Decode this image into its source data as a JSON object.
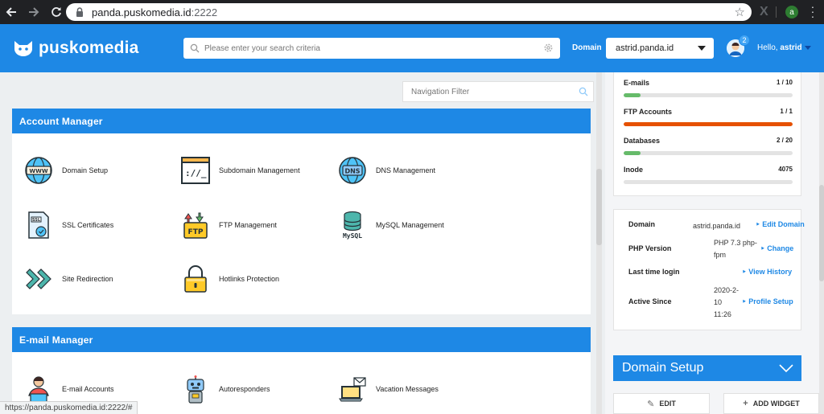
{
  "browser": {
    "url_host": "panda.puskomedia.id",
    "url_port": ":2222",
    "profile_initial": "a"
  },
  "header": {
    "brand": "puskomedia",
    "search_placeholder": "Please enter your search criteria",
    "domain_label": "Domain",
    "domain_value": "astrid.panda.id",
    "notification_count": "2",
    "hello_prefix": "Hello,",
    "username": "astrid"
  },
  "nav_filter": {
    "placeholder": "Navigation Filter"
  },
  "account_manager": {
    "title": "Account Manager",
    "items": [
      {
        "label": "Domain Setup",
        "icon": "globe-www-icon"
      },
      {
        "label": "Subdomain Management",
        "icon": "terminal-window-icon"
      },
      {
        "label": "DNS Management",
        "icon": "dns-globe-icon"
      },
      {
        "label": "SSL Certificates",
        "icon": "ssl-document-icon"
      },
      {
        "label": "FTP Management",
        "icon": "ftp-folder-icon"
      },
      {
        "label": "MySQL Management",
        "icon": "mysql-database-icon"
      },
      {
        "label": "Site Redirection",
        "icon": "redirect-arrows-icon"
      },
      {
        "label": "Hotlinks Protection",
        "icon": "padlock-icon"
      }
    ]
  },
  "email_manager": {
    "title": "E-mail Manager",
    "items": [
      {
        "label": "E-mail Accounts",
        "icon": "email-user-icon"
      },
      {
        "label": "Autoresponders",
        "icon": "robot-icon"
      },
      {
        "label": "Vacation Messages",
        "icon": "laptop-mail-icon"
      }
    ]
  },
  "usage": [
    {
      "name": "E-mails",
      "value": "1 / 10",
      "fraction": 0.1,
      "color": "#66bb6a"
    },
    {
      "name": "FTP Accounts",
      "value": "1 / 1",
      "fraction": 1.0,
      "color": "#e65100"
    },
    {
      "name": "Databases",
      "value": "2 / 20",
      "fraction": 0.1,
      "color": "#66bb6a"
    },
    {
      "name": "Inode",
      "value": "4075",
      "fraction": 0,
      "color": "#66bb6a"
    }
  ],
  "info": {
    "domain_key": "Domain",
    "domain_val": "astrid.panda.id",
    "domain_action": "Edit Domain",
    "php_key": "PHP Version",
    "php_val": "PHP 7.3 php-fpm",
    "php_action": "Change",
    "login_key": "Last time login",
    "login_action": "View History",
    "since_key": "Active Since",
    "since_val": "2020-2-10 11:26",
    "since_action": "Profile Setup"
  },
  "widget": {
    "title": "Domain Setup",
    "edit_label": "EDIT",
    "add_label": "ADD WIDGET"
  },
  "status_bar": {
    "url": "https://panda.puskomedia.id:2222/#"
  },
  "colors": {
    "brand_blue": "#1e88e5",
    "chrome_dark": "#202124"
  }
}
